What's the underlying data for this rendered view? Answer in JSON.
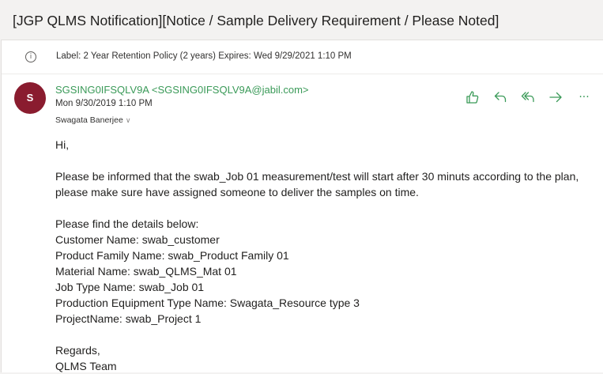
{
  "subject": "[JGP QLMS Notification][Notice / Sample Delivery Requirement / Please Noted]",
  "label_bar": {
    "icon": "info-icon",
    "text": "Label: 2 Year Retention Policy (2 years) Expires: Wed 9/29/2021 1:10 PM"
  },
  "message": {
    "avatar_initial": "S",
    "sender": "SGSING0IFSQLV9A <SGSING0IFSQLV9A@jabil.com>",
    "date": "Mon 9/30/2019 1:10 PM",
    "recipient": "Swagata Banerjee",
    "actions": [
      {
        "name": "like-button",
        "icon": "thumbs-up-icon",
        "glyph": "👍"
      },
      {
        "name": "reply-button",
        "icon": "reply-icon",
        "glyph": "↶"
      },
      {
        "name": "reply-all-button",
        "icon": "reply-all-icon",
        "glyph": "⟲"
      },
      {
        "name": "forward-button",
        "icon": "forward-icon",
        "glyph": "→"
      },
      {
        "name": "more-actions-button",
        "icon": "more-icon",
        "glyph": "···"
      }
    ]
  },
  "body": {
    "greeting": "Hi,",
    "paragraph": "Please be informed that the swab_Job 01 measurement/test will start after 30 minuts according to the plan, please make sure have assigned someone to deliver the samples on time.",
    "details_intro": "Please find the details below:",
    "details": [
      "Customer Name: swab_customer",
      "Product Family Name: swab_Product Family 01",
      "Material Name: swab_QLMS_Mat 01",
      "Job Type Name: swab_Job 01",
      "Production Equipment Type Name: Swagata_Resource type 3",
      "ProjectName: swab_Project 1"
    ],
    "closing": "Regards,",
    "signature": "QLMS Team"
  },
  "colors": {
    "accent_green": "#3a9a58",
    "avatar_bg": "#8a1c2f",
    "page_bg": "#f3f2f1"
  }
}
